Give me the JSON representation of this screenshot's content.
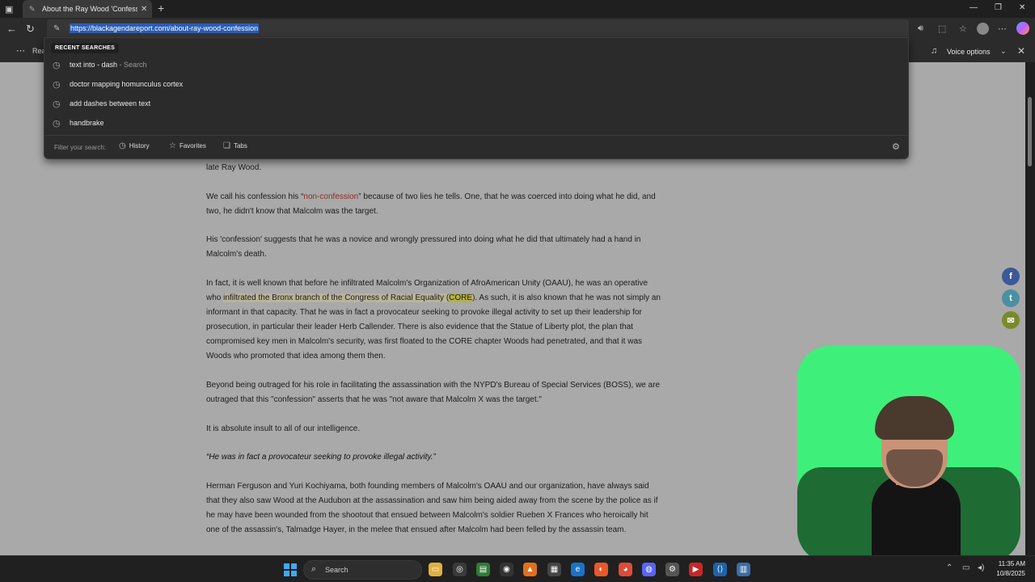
{
  "browser": {
    "tab_title": "About the Ray Wood 'Confession",
    "url": "https://blackagendareport.com/about-ray-wood-confession",
    "reader_label": "Rea",
    "voice_options": "Voice options"
  },
  "dropdown": {
    "header": "RECENT SEARCHES",
    "items": [
      {
        "text": "text into - dash",
        "sub": " - Search"
      },
      {
        "text": "doctor mapping homunculus cortex",
        "sub": ""
      },
      {
        "text": "add dashes between text",
        "sub": ""
      },
      {
        "text": "handbrake",
        "sub": ""
      }
    ],
    "filter_label": "Filter your search:",
    "chips": [
      "History",
      "Favorites",
      "Tabs"
    ]
  },
  "article": {
    "p0": "late Ray Wood.",
    "p1_a": "We call his confession his “",
    "p1_red": "non-confession",
    "p1_b": "” because of two lies he tells. One, that he was coerced into doing what he did, and two, he didn't know that Malcolm was the target.",
    "p2": "His 'confession' suggests that he was a novice and wrongly pressured into doing what he did that ultimately had a hand in Malcolm's death.",
    "p3_a": "In fact, it is well known that before he infiltrated Malcolm's Organization of AfroAmerican Unity (OAAU), he was an operative who ",
    "p3_hl": "infiltrated the Bronx branch of the Congress of Racial Equality (",
    "p3_hl2": "CORE",
    "p3_hl3": ")",
    "p3_b": ". As such, it is also known that he was not simply an informant in that capacity. That he was in fact a provocateur seeking to provoke illegal activity to set up their leadership for prosecution, in particular their leader Herb Callender. There is also evidence that the Statue of Liberty plot, the plan that compromised key men in Malcolm's security, was first floated to the CORE chapter Woods had penetrated, and that it was Woods who promoted that idea among them then.",
    "p4": "Beyond being outraged for his role in facilitating the assassination with the NYPD's Bureau of Special Services (BOSS), we are outraged that this \"confession\" asserts that he was \"not aware that Malcolm X was the target.\"",
    "p5": "It is absolute insult to all of our intelligence.",
    "p6": "“He was in fact a provocateur seeking to provoke illegal activity.”",
    "p7": "Herman Ferguson and Yuri Kochiyama, both founding members of Malcolm's OAAU and our organization, have always said that they also saw Wood at the Audubon at the assassination and saw him being aided away from the scene by the police as if he may have been wounded from the shootout that ensued between Malcolm's soldier Rueben X Frances who heroically hit one of the assassin's, Talmadge Hayer, in the melee that ensued after Malcolm had been felled by the assassin team."
  },
  "share": [
    {
      "icon": "facebook-icon",
      "glyph": "f",
      "color": "#3b5998"
    },
    {
      "icon": "twitter-icon",
      "glyph": "t",
      "color": "#4a90a4"
    },
    {
      "icon": "email-icon",
      "glyph": "✉",
      "color": "#7a8a2a"
    }
  ],
  "taskbar": {
    "search_placeholder": "Search",
    "time": "11:35 AM",
    "date": "10/8/2025"
  }
}
